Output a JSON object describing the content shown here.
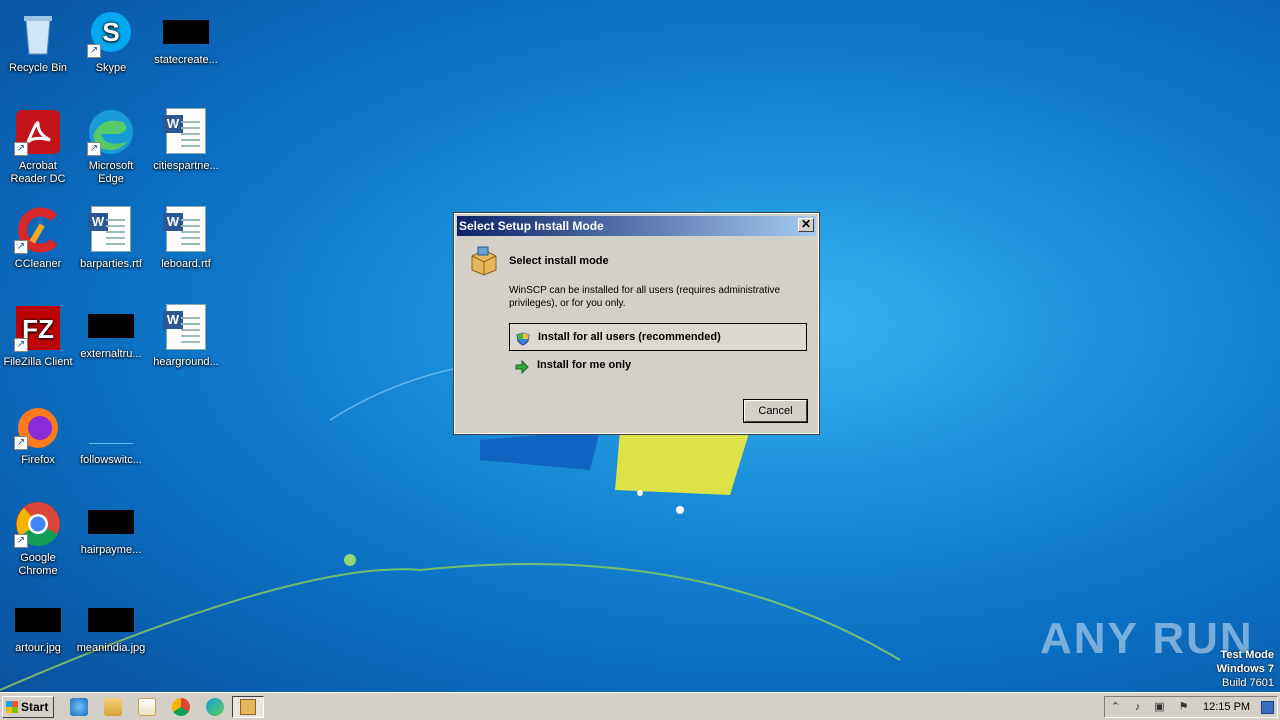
{
  "desktop": {
    "icons": [
      {
        "label": "Recycle Bin",
        "icon": "recycle-bin-icon"
      },
      {
        "label": "Skype",
        "icon": "skype-icon"
      },
      {
        "label": "statecreate...",
        "icon": "redacted-file-icon"
      },
      {
        "label": "Acrobat Reader DC",
        "icon": "acrobat-icon"
      },
      {
        "label": "Microsoft Edge",
        "icon": "edge-icon"
      },
      {
        "label": "citiespartne...",
        "icon": "word-doc-icon"
      },
      {
        "label": "CCleaner",
        "icon": "ccleaner-icon"
      },
      {
        "label": "barparties.rtf",
        "icon": "word-doc-icon"
      },
      {
        "label": "leboard.rtf",
        "icon": "word-doc-icon"
      },
      {
        "label": "FileZilla Client",
        "icon": "filezilla-icon"
      },
      {
        "label": "externaltru...",
        "icon": "redacted-file-icon"
      },
      {
        "label": "hearground...",
        "icon": "word-doc-icon"
      },
      {
        "label": "Firefox",
        "icon": "firefox-icon"
      },
      {
        "label": "followswitc...",
        "icon": "blank-file-icon"
      },
      {
        "label": "Google Chrome",
        "icon": "chrome-icon"
      },
      {
        "label": "hairpayme...",
        "icon": "redacted-file-icon"
      },
      {
        "label": "artour.jpg",
        "icon": "redacted-file-icon"
      },
      {
        "label": "meanindia.jpg",
        "icon": "redacted-file-icon"
      }
    ]
  },
  "dialog": {
    "title": "Select Setup Install Mode",
    "heading": "Select install mode",
    "description": "WinSCP can be installed for all users (requires administrative privileges), or for you only.",
    "option_all_users": "Install for all users (recommended)",
    "option_me_only": "Install for me only",
    "cancel": "Cancel",
    "close": "✕"
  },
  "taskbar": {
    "start": "Start",
    "clock": "12:15 PM"
  },
  "watermark": {
    "line1": "Test Mode",
    "line2": "Windows 7",
    "line3": "Build 7601",
    "brand": "ANY RUN"
  }
}
